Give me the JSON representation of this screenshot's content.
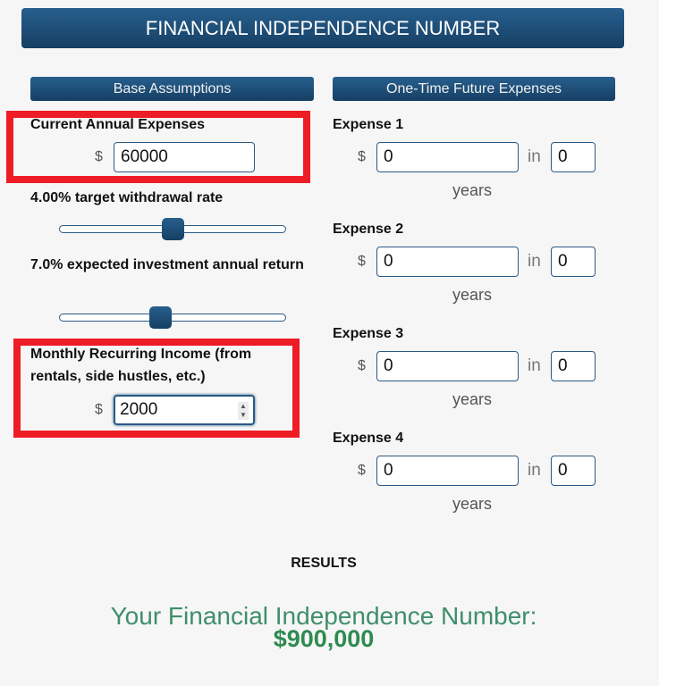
{
  "header": {
    "title": "FINANCIAL INDEPENDENCE NUMBER"
  },
  "base_assumptions": {
    "section_title": "Base Assumptions",
    "current_annual_expenses": {
      "label": "Current Annual Expenses",
      "currency": "$",
      "value": "60000"
    },
    "withdrawal_rate": {
      "label": "4.00% target withdrawal rate",
      "value_percent": 4.0,
      "slider_fraction": 0.5
    },
    "investment_return": {
      "label": "7.0% expected investment annual return",
      "value_percent": 7.0,
      "slider_fraction": 0.44
    },
    "monthly_recurring_income": {
      "label": "Monthly Recurring Income (from rentals, side hustles, etc.)",
      "currency": "$",
      "value": "2000"
    }
  },
  "one_time_expenses": {
    "section_title": "One-Time Future Expenses",
    "in_label": "in",
    "years_label": "years",
    "currency": "$",
    "items": [
      {
        "label": "Expense 1",
        "amount": "0",
        "years": "0"
      },
      {
        "label": "Expense 2",
        "amount": "0",
        "years": "0"
      },
      {
        "label": "Expense 3",
        "amount": "0",
        "years": "0"
      },
      {
        "label": "Expense 4",
        "amount": "0",
        "years": "0"
      }
    ]
  },
  "results": {
    "title": "RESULTS",
    "fi_label": "Your Financial Independence Number:",
    "fi_value": "$900,000"
  },
  "colors": {
    "header_blue": "#1f4e79",
    "highlight_red": "#ee1c25",
    "result_green": "#2e8b50"
  }
}
